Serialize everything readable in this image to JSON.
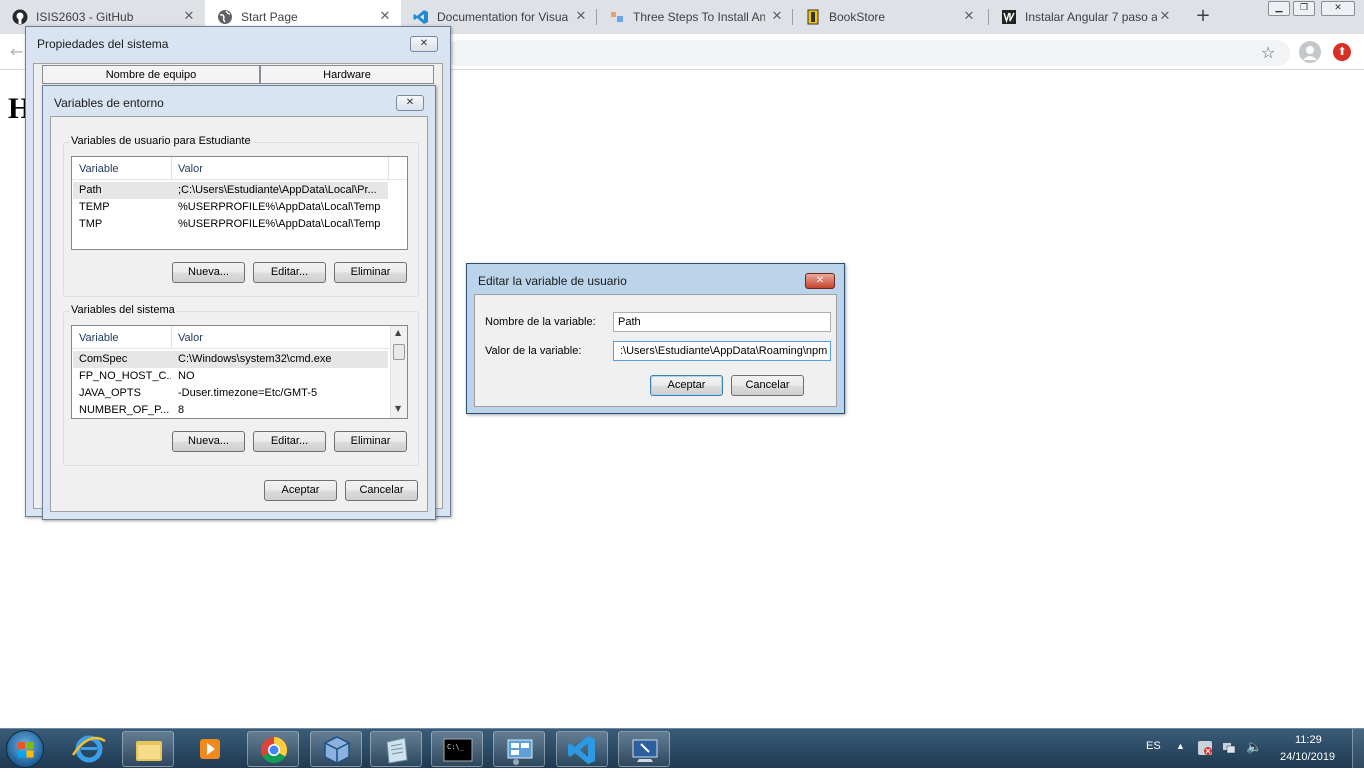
{
  "browser": {
    "tabs": [
      {
        "title": "ISIS2603 - GitHub",
        "icon": "github-icon"
      },
      {
        "title": "Start Page",
        "icon": "globe-icon"
      },
      {
        "title": "Documentation for Visua",
        "icon": "vscode-icon"
      },
      {
        "title": "Three Steps To Install An",
        "icon": "install-icon"
      },
      {
        "title": "BookStore",
        "icon": "bookstore-icon"
      },
      {
        "title": "Instalar Angular 7 paso a",
        "icon": "vm-icon"
      }
    ],
    "page_heading_fragment": "H"
  },
  "system_properties": {
    "title": "Propiedades del sistema",
    "tabs": [
      "Nombre de equipo",
      "Hardware"
    ]
  },
  "env_vars": {
    "title": "Variables de entorno",
    "user_group_label": "Variables de usuario para Estudiante",
    "system_group_label": "Variables del sistema",
    "col_variable": "Variable",
    "col_value": "Valor",
    "user_vars": [
      {
        "name": "Path",
        "value": ";C:\\Users\\Estudiante\\AppData\\Local\\Pr..."
      },
      {
        "name": "TEMP",
        "value": "%USERPROFILE%\\AppData\\Local\\Temp"
      },
      {
        "name": "TMP",
        "value": "%USERPROFILE%\\AppData\\Local\\Temp"
      }
    ],
    "system_vars": [
      {
        "name": "ComSpec",
        "value": "C:\\Windows\\system32\\cmd.exe"
      },
      {
        "name": "FP_NO_HOST_C...",
        "value": "NO"
      },
      {
        "name": "JAVA_OPTS",
        "value": "-Duser.timezone=Etc/GMT-5"
      },
      {
        "name": "NUMBER_OF_P...",
        "value": "8"
      }
    ],
    "btn_new": "Nueva...",
    "btn_edit": "Editar...",
    "btn_delete": "Eliminar",
    "btn_ok": "Aceptar",
    "btn_cancel": "Cancelar"
  },
  "edit_var": {
    "title": "Editar la variable de usuario",
    "name_label": "Nombre de la variable:",
    "name_value": "Path",
    "value_label": "Valor de la variable:",
    "value_value": ":\\Users\\Estudiante\\AppData\\Roaming\\npm",
    "btn_ok": "Aceptar",
    "btn_cancel": "Cancelar"
  },
  "taskbar": {
    "language": "ES",
    "time": "11:29",
    "date": "24/10/2019"
  },
  "colors": {
    "dialog_frame": "#d8e4f1",
    "taskbar": "#1f3a52",
    "tabstrip": "#dee1e6",
    "update_badge": "#d93025"
  }
}
